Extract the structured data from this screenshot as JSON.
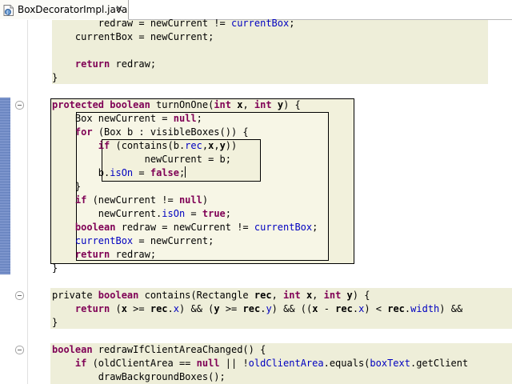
{
  "tab": {
    "title": "BoxDecoratorImpl.java",
    "close": "✕"
  },
  "code": [
    {
      "tokens": [
        [
          "",
          "        redraw = newCurrent != "
        ],
        [
          "fld",
          "currentBox"
        ],
        [
          "",
          ";"
        ]
      ]
    },
    {
      "tokens": [
        [
          "",
          "    currentBox = newCurrent;"
        ]
      ]
    },
    {
      "tokens": [
        [
          "",
          ""
        ]
      ]
    },
    {
      "tokens": [
        [
          "",
          "    "
        ],
        [
          "kw",
          "return"
        ],
        [
          "",
          " redraw;"
        ]
      ]
    },
    {
      "tokens": [
        [
          "",
          "}"
        ]
      ]
    },
    {
      "tokens": [
        [
          "",
          ""
        ]
      ]
    },
    {
      "tokens": [
        [
          "kw",
          "protected boolean"
        ],
        [
          "",
          " turnOnOne("
        ],
        [
          "kw",
          "int"
        ],
        [
          "",
          " "
        ],
        [
          "bold",
          "x"
        ],
        [
          "",
          ", "
        ],
        [
          "kw",
          "int"
        ],
        [
          "",
          " "
        ],
        [
          "bold",
          "y"
        ],
        [
          "",
          ") {"
        ]
      ]
    },
    {
      "tokens": [
        [
          "",
          "    Box newCurrent = "
        ],
        [
          "kw",
          "null"
        ],
        [
          "",
          ";"
        ]
      ]
    },
    {
      "tokens": [
        [
          "",
          "    "
        ],
        [
          "kw",
          "for"
        ],
        [
          "",
          " (Box b : visibleBoxes()) {"
        ]
      ]
    },
    {
      "tokens": [
        [
          "",
          "        "
        ],
        [
          "kw",
          "if"
        ],
        [
          "",
          " (contains(b."
        ],
        [
          "fld",
          "rec"
        ],
        [
          "",
          ","
        ],
        [
          "bold",
          "x"
        ],
        [
          "",
          ","
        ],
        [
          "bold",
          "y"
        ],
        [
          "",
          "))"
        ]
      ]
    },
    {
      "tokens": [
        [
          "",
          "                newCurrent = b;"
        ]
      ]
    },
    {
      "tokens": [
        [
          "",
          "        b."
        ],
        [
          "fld",
          "isOn"
        ],
        [
          "",
          " = "
        ],
        [
          "kw",
          "false"
        ],
        [
          "",
          ";"
        ]
      ],
      "caret": true
    },
    {
      "tokens": [
        [
          "",
          "    }"
        ]
      ]
    },
    {
      "tokens": [
        [
          "",
          "    "
        ],
        [
          "kw",
          "if"
        ],
        [
          "",
          " (newCurrent != "
        ],
        [
          "kw",
          "null"
        ],
        [
          "",
          ")"
        ]
      ]
    },
    {
      "tokens": [
        [
          "",
          "        newCurrent."
        ],
        [
          "fld",
          "isOn"
        ],
        [
          "",
          " = "
        ],
        [
          "kw",
          "true"
        ],
        [
          "",
          ";"
        ]
      ]
    },
    {
      "tokens": [
        [
          "",
          "    "
        ],
        [
          "kw",
          "boolean"
        ],
        [
          "",
          " redraw = newCurrent != "
        ],
        [
          "fld",
          "currentBox"
        ],
        [
          "",
          ";"
        ]
      ]
    },
    {
      "tokens": [
        [
          "",
          "    "
        ],
        [
          "fld",
          "currentBox"
        ],
        [
          "",
          " = newCurrent;"
        ]
      ]
    },
    {
      "tokens": [
        [
          "",
          "    "
        ],
        [
          "kw",
          "return"
        ],
        [
          "",
          " redraw;"
        ]
      ]
    },
    {
      "tokens": [
        [
          "",
          "}"
        ]
      ]
    },
    {
      "tokens": [
        [
          "",
          ""
        ]
      ]
    },
    {
      "tokens": [
        [
          "",
          "private "
        ],
        [
          "kw",
          "boolean"
        ],
        [
          "",
          " contains(Rectangle "
        ],
        [
          "bold",
          "rec"
        ],
        [
          "",
          ", "
        ],
        [
          "kw",
          "int"
        ],
        [
          "",
          " "
        ],
        [
          "bold",
          "x"
        ],
        [
          "",
          ", "
        ],
        [
          "kw",
          "int"
        ],
        [
          "",
          " "
        ],
        [
          "bold",
          "y"
        ],
        [
          "",
          ") {"
        ]
      ]
    },
    {
      "tokens": [
        [
          "",
          "    "
        ],
        [
          "kw",
          "return"
        ],
        [
          "",
          " ("
        ],
        [
          "bold",
          "x"
        ],
        [
          "",
          " >= "
        ],
        [
          "bold",
          "rec"
        ],
        [
          "",
          "."
        ],
        [
          "fld",
          "x"
        ],
        [
          "",
          ") && ("
        ],
        [
          "bold",
          "y"
        ],
        [
          "",
          " >= "
        ],
        [
          "bold",
          "rec"
        ],
        [
          "",
          "."
        ],
        [
          "fld",
          "y"
        ],
        [
          "",
          ") && (("
        ],
        [
          "bold",
          "x"
        ],
        [
          "",
          " - "
        ],
        [
          "bold",
          "rec"
        ],
        [
          "",
          "."
        ],
        [
          "fld",
          "x"
        ],
        [
          "",
          ") < "
        ],
        [
          "bold",
          "rec"
        ],
        [
          "",
          "."
        ],
        [
          "fld",
          "width"
        ],
        [
          "",
          ") &&"
        ]
      ]
    },
    {
      "tokens": [
        [
          "",
          "}"
        ]
      ]
    },
    {
      "tokens": [
        [
          "",
          ""
        ]
      ]
    },
    {
      "tokens": [
        [
          "kw",
          "boolean"
        ],
        [
          "",
          " redrawIfClientAreaChanged() {"
        ]
      ]
    },
    {
      "tokens": [
        [
          "",
          "    "
        ],
        [
          "kw",
          "if"
        ],
        [
          "",
          " (oldClientArea == "
        ],
        [
          "kw",
          "null"
        ],
        [
          "",
          " || !"
        ],
        [
          "fld",
          "oldClientArea"
        ],
        [
          "",
          ".equals("
        ],
        [
          "fld",
          "boxText"
        ],
        [
          "",
          ".getClient"
        ]
      ]
    },
    {
      "tokens": [
        [
          "",
          "        drawBackgroundBoxes();"
        ]
      ]
    }
  ],
  "colors": {
    "keyword": "#7f0055",
    "field": "#0000c0",
    "box": "#eeeed9",
    "quickdiff": "#6b86c4"
  }
}
